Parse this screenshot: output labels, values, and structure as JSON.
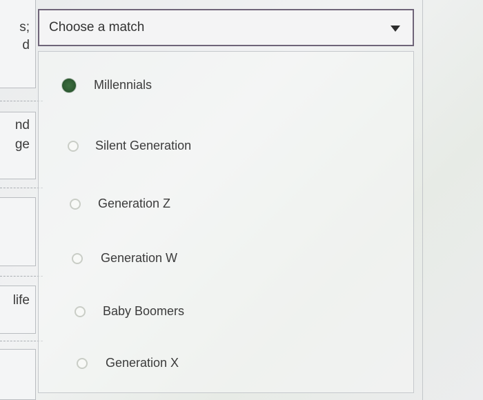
{
  "dropdown": {
    "label": "Choose a match"
  },
  "options": [
    {
      "label": "Millennials",
      "selected": true
    },
    {
      "label": "Silent Generation",
      "selected": false
    },
    {
      "label": "Generation Z",
      "selected": false
    },
    {
      "label": "Generation W",
      "selected": false
    },
    {
      "label": "Baby Boomers",
      "selected": false
    },
    {
      "label": "Generation X",
      "selected": false
    }
  ],
  "left_fragments": [
    "s;",
    "d",
    "nd",
    "ge",
    "life"
  ],
  "colors": {
    "selected_radio": "#356338",
    "dropdown_border": "#6e6478"
  }
}
